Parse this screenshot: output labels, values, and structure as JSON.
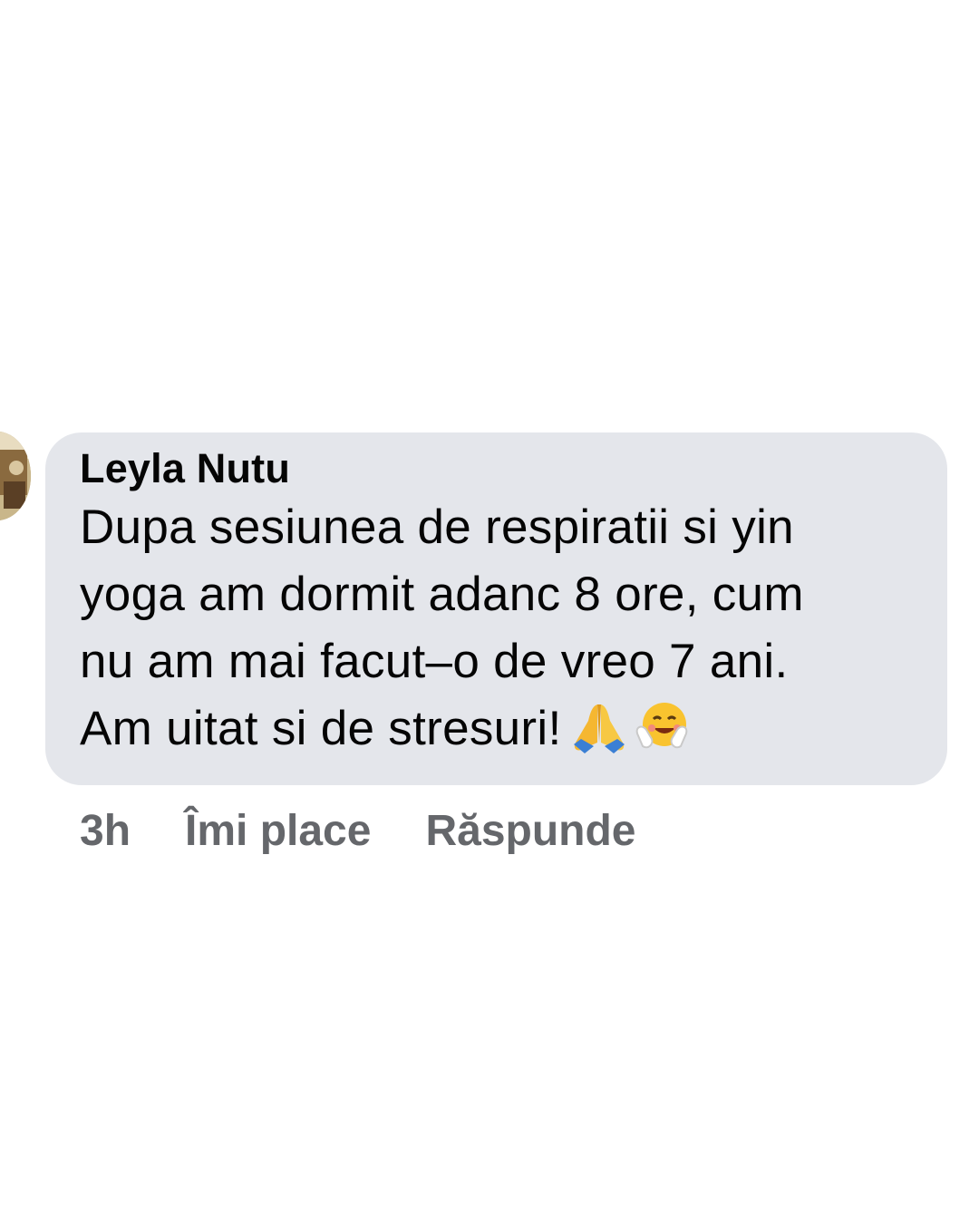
{
  "comment": {
    "author": "Leyla Nutu",
    "text_lines": [
      "Dupa sesiunea de respiratii si yin",
      "yoga am dormit adanc 8 ore, cum",
      "nu am mai facut–o de vreo 7 ani.",
      "Am uitat si de stresuri!"
    ],
    "emojis": [
      "folded-hands-emoji",
      "hugging-face-emoji"
    ],
    "bubble_color": "#e4e6eb",
    "text_color": "#050505"
  },
  "actions": {
    "time": "3h",
    "like_label": "Îmi place",
    "reply_label": "Răspunde",
    "color": "#65676b"
  }
}
